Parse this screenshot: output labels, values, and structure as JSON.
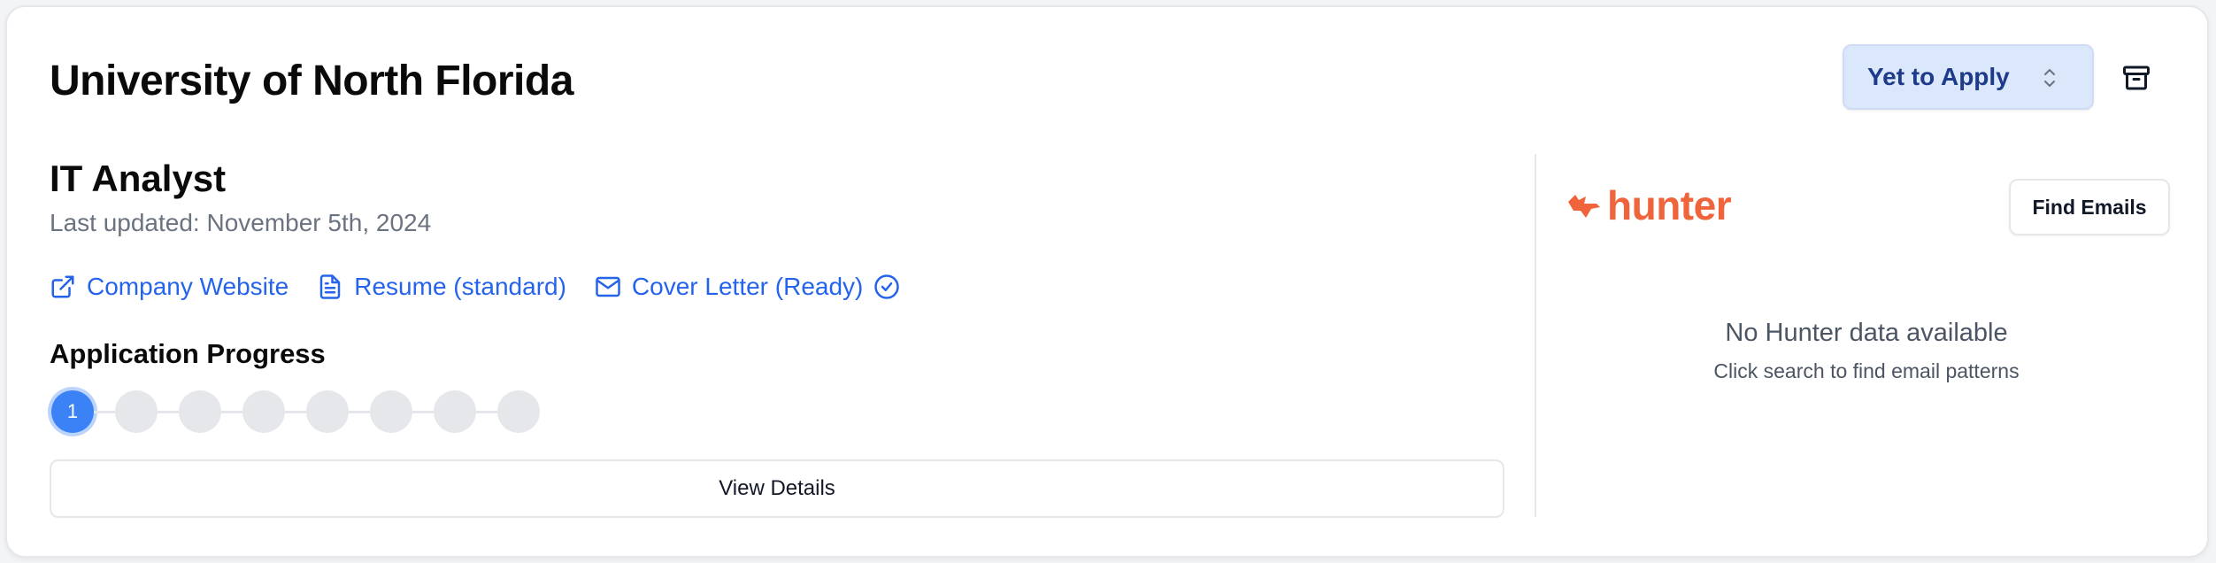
{
  "card": {
    "title": "University of North Florida",
    "status": {
      "selected": "Yet to Apply"
    }
  },
  "job": {
    "title": "IT Analyst",
    "last_updated": "Last updated: November 5th, 2024",
    "links": {
      "company_website": "Company Website",
      "resume": "Resume (standard)",
      "cover_letter": "Cover Letter (Ready)"
    },
    "progress": {
      "title": "Application Progress",
      "current_step_label": "1",
      "total_steps": 8,
      "current_step": 1
    },
    "view_details_label": "View Details"
  },
  "hunter": {
    "logo_text": "hunter",
    "find_emails_label": "Find Emails",
    "empty_title": "No Hunter data available",
    "empty_subtitle": "Click search to find email patterns"
  },
  "colors": {
    "link": "#2563eb",
    "status_bg": "#dbe7fb",
    "status_text": "#1e3a8a",
    "step_active": "#3b82f6",
    "step_inactive": "#e5e7eb",
    "hunter_brand": "#f0643c"
  },
  "icons": {
    "status_chevron": "chevron-up-down-icon",
    "archive": "archive-icon",
    "company_website": "external-link-icon",
    "resume": "document-icon",
    "cover_letter": "mail-icon",
    "cover_letter_status": "check-circle-icon",
    "hunter_logo": "fox-icon"
  }
}
